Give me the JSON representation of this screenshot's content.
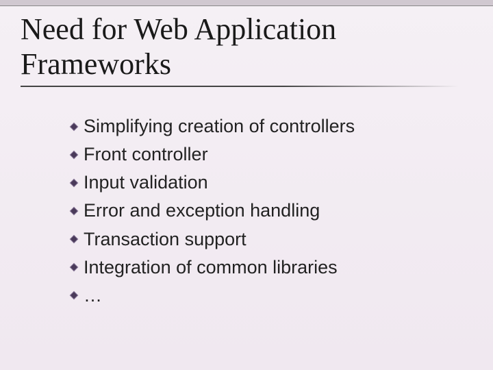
{
  "title_line1": "Need for Web Application",
  "title_line2": "Frameworks",
  "bullets": [
    "Simplifying creation of controllers",
    "Front controller",
    "Input validation",
    "Error and exception handling",
    "Transaction support",
    "Integration of common libraries",
    "…"
  ]
}
